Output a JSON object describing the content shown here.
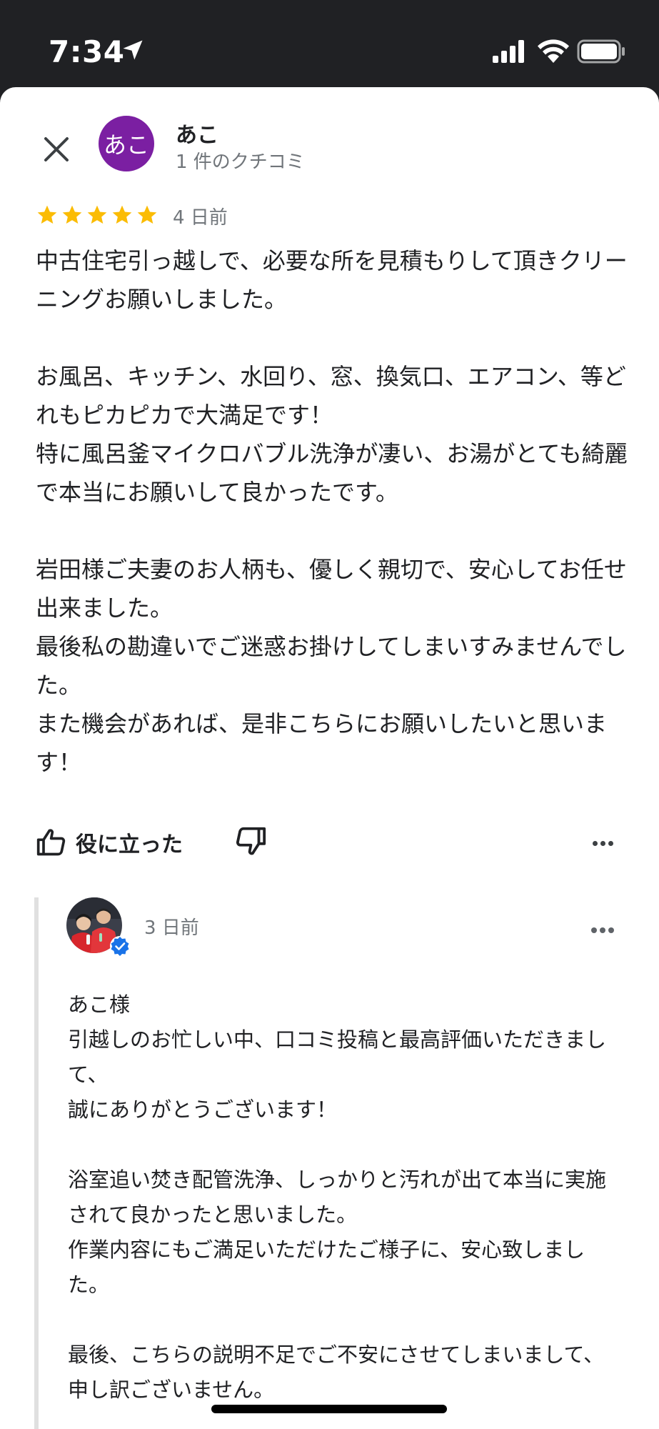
{
  "status_bar": {
    "time": "7:34"
  },
  "reviewer": {
    "name": "あこ",
    "avatar_text": "あこ",
    "avatar_color": "#7B1FA2",
    "review_count": "1 件のクチコミ"
  },
  "review": {
    "rating": 5,
    "date": "4 日前",
    "body": "中古住宅引っ越しで、必要な所を見積もりして頂きクリーニングお願いしました。\n\nお風呂、キッチン、水回り、窓、換気口、エアコン、等どれもピカピカで大満足です！\n特に風呂釜マイクロバブル洗浄が凄い、お湯がとても綺麗で本当にお願いして良かったです。\n\n岩田様ご夫妻のお人柄も、優しく親切で、安心してお任せ出来ました。\n最後私の勘違いでご迷惑お掛けしてしまいすみませんでした。\nまた機会があれば、是非こちらにお願いしたいと思います！",
    "helpful_label": "役に立った"
  },
  "owner_reply": {
    "date": "3 日前",
    "body": "あこ様\n引越しのお忙しい中、口コミ投稿と最高評価いただきまして、\n誠にありがとうございます！\n\n浴室追い焚き配管洗浄、しっかりと汚れが出て本当に実施されて良かったと思いました。\n作業内容にもご満足いただけたご様子に、安心致しました。\n\n最後、こちらの説明不足でご不安にさせてしまいまして、\n申し訳ございません。"
  },
  "colors": {
    "star": "#FBBC04",
    "verified": "#1A73E8",
    "secondary_text": "#70757a"
  }
}
